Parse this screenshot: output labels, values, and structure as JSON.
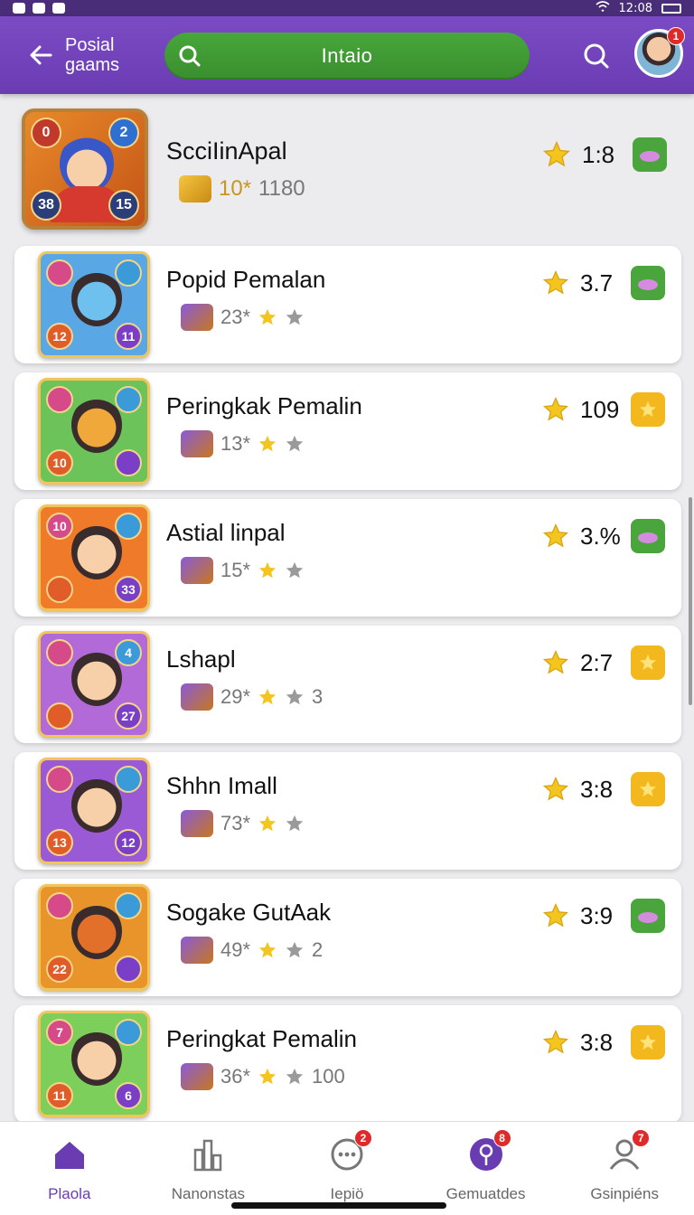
{
  "status_bar": {
    "time": "12:08"
  },
  "app_bar": {
    "title": "Posial gaams",
    "search_text": "Intaio",
    "avatar_badge": "1"
  },
  "me": {
    "name": "ScciIinApal",
    "sub_gold": "10*",
    "sub_grey": "1180",
    "rating": "1:8",
    "tile_corners": [
      "0",
      "2",
      "38",
      "15"
    ],
    "gem": "green"
  },
  "players": [
    {
      "name": "Popid Pemalan",
      "count": "23*",
      "tail": "",
      "rating": "3.7",
      "gem": "green",
      "corners": [
        "",
        "",
        "12",
        "11"
      ],
      "tile_color": "#5aa7e6",
      "face": "#6ec0ee"
    },
    {
      "name": "Peringkak Pemalin",
      "count": "13*",
      "tail": "",
      "rating": "109",
      "gem": "yellow",
      "corners": [
        "",
        "",
        "10",
        ""
      ],
      "tile_color": "#6cc35a",
      "face": "#f0a83a"
    },
    {
      "name": "Astial linpal",
      "count": "15*",
      "tail": "",
      "rating": "3.%",
      "gem": "green",
      "corners": [
        "10",
        "",
        "",
        "33"
      ],
      "tile_color": "#ef7a2a",
      "face": "#f7cfa8"
    },
    {
      "name": "Lshapl",
      "count": "29*",
      "tail": "3",
      "rating": "2:7",
      "gem": "yellow",
      "corners": [
        "",
        "4",
        "",
        "27"
      ],
      "tile_color": "#b36ad9",
      "face": "#f7cfa8"
    },
    {
      "name": "Shhn Imall",
      "count": "73*",
      "tail": "",
      "rating": "3:8",
      "gem": "yellow",
      "corners": [
        "",
        "",
        "13",
        "12"
      ],
      "tile_color": "#9a5ad6",
      "face": "#f7cfa8"
    },
    {
      "name": "Sogake GutAak",
      "count": "49*",
      "tail": "2",
      "rating": "3:9",
      "gem": "green",
      "corners": [
        "",
        "",
        "22",
        ""
      ],
      "tile_color": "#e8942a",
      "face": "#e2702a"
    },
    {
      "name": "Peringkat Pemalin",
      "count": "36*",
      "tail": "100",
      "rating": "3:8",
      "gem": "yellow",
      "corners": [
        "7",
        "",
        "11",
        "6"
      ],
      "tile_color": "#7ccf5a",
      "face": "#f7cfa8"
    }
  ],
  "nav": [
    {
      "label": "Plaola",
      "icon": "home-icon",
      "badge": ""
    },
    {
      "label": "Nanonstas",
      "icon": "podium-icon",
      "badge": ""
    },
    {
      "label": "Iepiö",
      "icon": "chat-icon",
      "badge": "2"
    },
    {
      "label": "Gemuatdes",
      "icon": "pin-icon",
      "badge": "8"
    },
    {
      "label": "Gsinpiéns",
      "icon": "profile-icon",
      "badge": "7"
    }
  ],
  "colors": {
    "primary": "#6a3cb2",
    "search": "#47a73a",
    "star": "#f3c51e",
    "badge": "#e02929"
  }
}
